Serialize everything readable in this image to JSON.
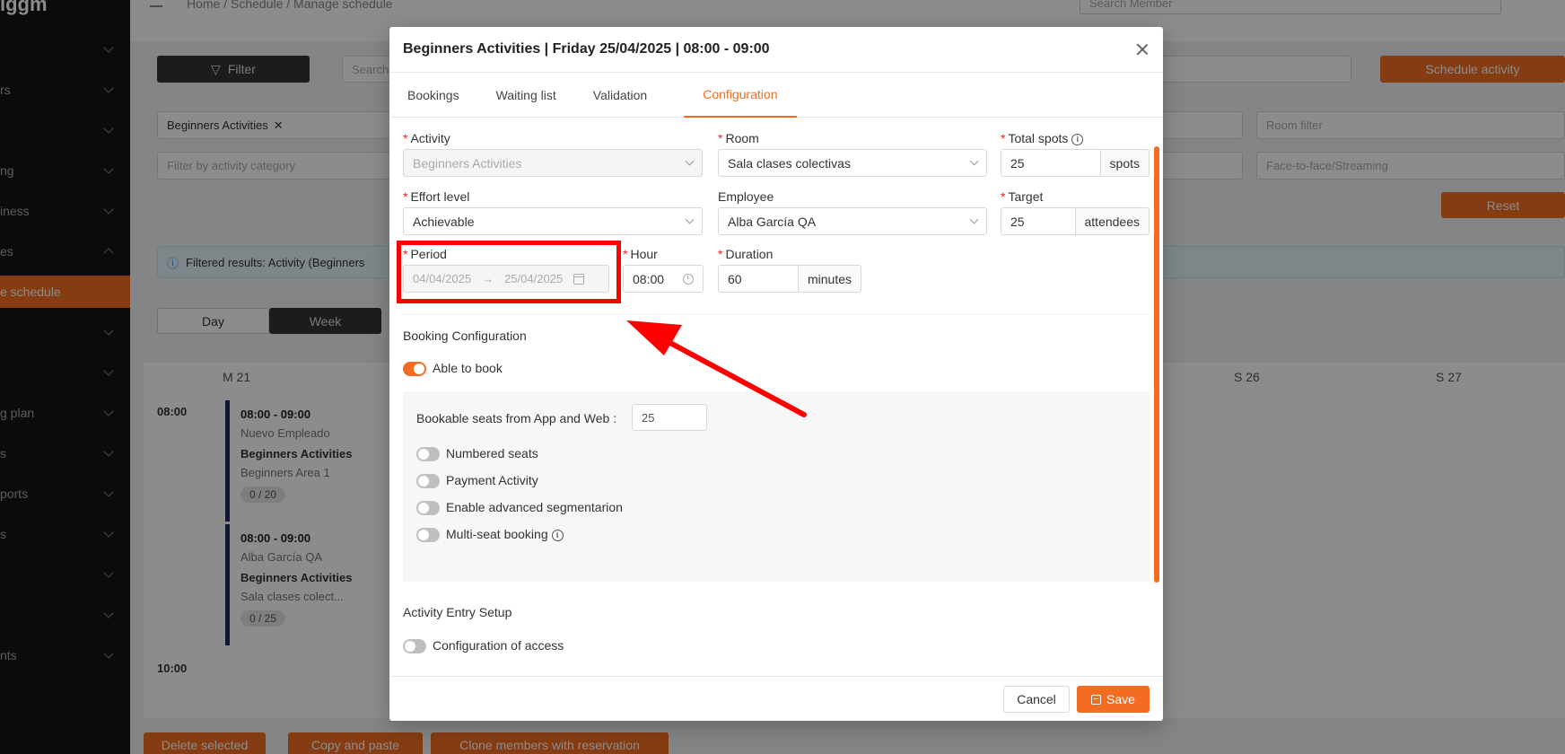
{
  "app": {
    "logo": "iggm",
    "breadcrumb": "Home  /  Schedule  /  Manage schedule",
    "search_member_placeholder": "Search Member"
  },
  "sidebar": {
    "items": [
      {
        "label": "",
        "chevron": "down"
      },
      {
        "label": "rs",
        "chevron": "down"
      },
      {
        "label": "",
        "chevron": "down"
      },
      {
        "label": "ng",
        "chevron": "down"
      },
      {
        "label": "iness",
        "chevron": "down"
      },
      {
        "label": "es",
        "chevron": "up"
      },
      {
        "label": "e schedule",
        "active": true
      },
      {
        "label": "",
        "chevron": "down"
      },
      {
        "label": "",
        "chevron": "down"
      },
      {
        "label": "g plan",
        "chevron": "down"
      },
      {
        "label": "s",
        "chevron": "down"
      },
      {
        "label": "ports",
        "chevron": "down"
      },
      {
        "label": "s",
        "chevron": "down"
      },
      {
        "label": "",
        "chevron": "down"
      },
      {
        "label": "",
        "chevron": "down"
      },
      {
        "label": "nts",
        "chevron": "down"
      }
    ]
  },
  "background": {
    "filter_button": "Filter",
    "search_placeholder": "Search",
    "schedule_activity_button": "Schedule activity",
    "activity_tag": "Beginners Activities",
    "room_filter_placeholder": "Room filter",
    "category_placeholder": "Filter by activity category",
    "mode_placeholder": "Face-to-face/Streaming",
    "reset_button": "Reset",
    "filtered_results": "Filtered results: Activity (Beginners",
    "day_button": "Day",
    "week_button": "Week",
    "day_headers": [
      "M 21",
      "S 26",
      "S 27"
    ],
    "time_labels": [
      "08:00",
      "10:00"
    ],
    "events": [
      {
        "time": "08:00 - 09:00",
        "employee": "Nuevo Empleado",
        "activity": "Beginners Activities",
        "room": "Beginners Area 1",
        "count": "0 / 20"
      },
      {
        "time": "08:00 - 09:00",
        "employee": "Alba García QA",
        "activity": "Beginners Activities",
        "room": "Sala clases colect...",
        "count": "0 / 25"
      }
    ],
    "bottom_buttons": [
      "Delete selected",
      "Copy and paste",
      "Clone members with reservation"
    ]
  },
  "modal": {
    "title": "Beginners Activities | Friday 25/04/2025 | 08:00 - 09:00",
    "tabs": [
      "Bookings",
      "Waiting list",
      "Validation",
      "Configuration"
    ],
    "active_tab": "Configuration",
    "fields": {
      "activity": {
        "label": "Activity",
        "value": "Beginners Activities"
      },
      "room": {
        "label": "Room",
        "value": "Sala clases colectivas"
      },
      "total_spots": {
        "label": "Total spots",
        "value": "25",
        "unit": "spots"
      },
      "effort_level": {
        "label": "Effort level",
        "value": "Achievable"
      },
      "employee": {
        "label": "Employee",
        "value": "Alba García QA"
      },
      "target": {
        "label": "Target",
        "value": "25",
        "unit": "attendees"
      },
      "period": {
        "label": "Period",
        "start": "04/04/2025",
        "end": "25/04/2025"
      },
      "hour": {
        "label": "Hour",
        "value": "08:00"
      },
      "duration": {
        "label": "Duration",
        "value": "60",
        "unit": "minutes"
      }
    },
    "booking_config": {
      "title": "Booking Configuration",
      "able_to_book": "Able to book",
      "bookable_seats_label": "Bookable seats from App and Web :",
      "bookable_seats_value": "25",
      "numbered_seats": "Numbered seats",
      "payment_activity": "Payment Activity",
      "advanced_segmentation": "Enable advanced segmentarion",
      "multi_seat": "Multi-seat booking"
    },
    "entry_setup": {
      "title": "Activity Entry Setup",
      "access_config": "Configuration of access"
    },
    "cancel_button": "Cancel",
    "save_button": "Save"
  },
  "colors": {
    "accent": "#f26d21",
    "sidebar_bg": "#141414",
    "annotation_red": "#ff0000",
    "event_border": "#1f2a6b"
  }
}
